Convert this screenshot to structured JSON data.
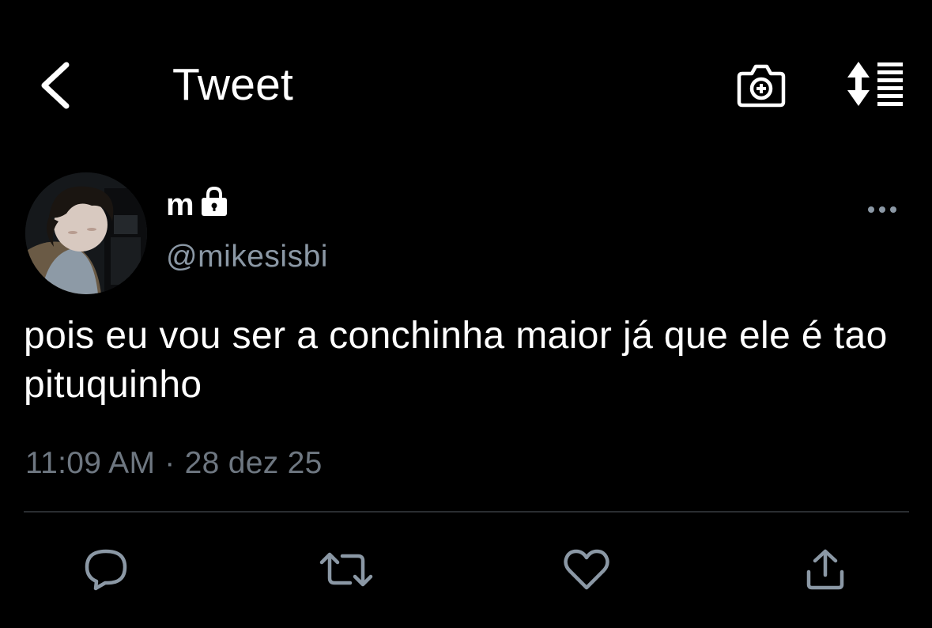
{
  "nav": {
    "title": "Tweet",
    "back_icon": "chevron-left-icon",
    "camera_icon": "camera-plus-icon",
    "sort_icon": "sort-list-icon"
  },
  "tweet": {
    "author_name": "m",
    "protected_icon": "lock-icon",
    "handle": "@mikesisbi",
    "more_icon": "more-dots-icon",
    "text": "pois eu vou ser a conchinha maior já que ele é tao pituquinho",
    "time": "11:09 AM",
    "separator": "·",
    "date": "28 dez 25"
  },
  "actions": {
    "reply_icon": "reply-icon",
    "retweet_icon": "retweet-icon",
    "like_icon": "heart-icon",
    "share_icon": "share-icon"
  },
  "colors": {
    "background": "#000000",
    "text": "#ffffff",
    "secondary": "#8b98a5",
    "icon_muted": "#8b98a5",
    "divider": "#2a2d31"
  }
}
